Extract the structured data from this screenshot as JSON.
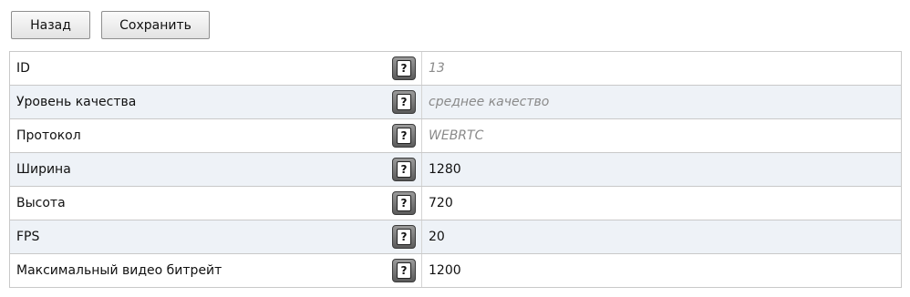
{
  "toolbar": {
    "back_label": "Назад",
    "save_label": "Сохранить"
  },
  "help_icon_glyph": "?",
  "rows": [
    {
      "label": "ID",
      "value": "13",
      "readonly": true
    },
    {
      "label": "Уровень качества",
      "value": "среднее качество",
      "readonly": true
    },
    {
      "label": "Протокол",
      "value": "WEBRTC",
      "readonly": true
    },
    {
      "label": "Ширина",
      "value": "1280",
      "readonly": false
    },
    {
      "label": "Высота",
      "value": "720",
      "readonly": false
    },
    {
      "label": "FPS",
      "value": "20",
      "readonly": false
    },
    {
      "label": "Максимальный видео битрейт",
      "value": "1200",
      "readonly": false
    }
  ],
  "colors": {
    "alt_row": "#eef2f7",
    "border": "#c9c9c9",
    "readonly_text": "#8a8a8a"
  }
}
